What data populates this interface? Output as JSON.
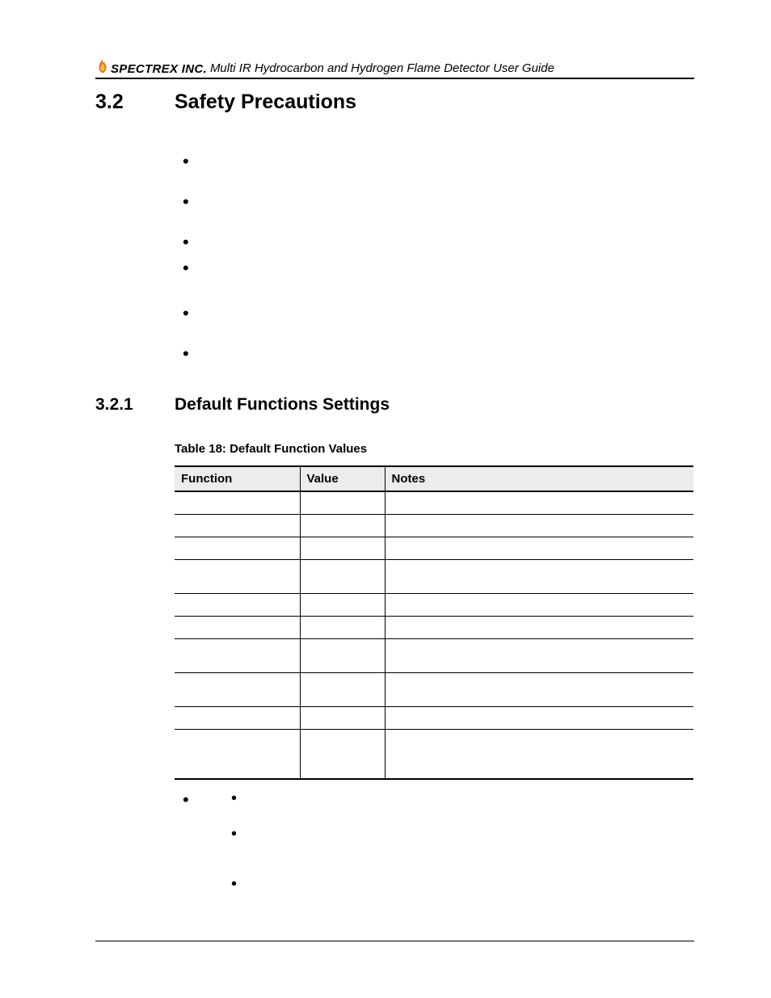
{
  "header": {
    "brand_main": "SPECTREX",
    "brand_suffix": " INC.",
    "doc_title": "Multi IR Hydrocarbon and Hydrogen Flame Detector User Guide"
  },
  "section": {
    "number": "3.2",
    "title": "Safety Precautions"
  },
  "safety_bullets": [
    "",
    "",
    "",
    "",
    "",
    ""
  ],
  "subsection": {
    "number": "3.2.1",
    "title": "Default Functions Settings"
  },
  "table": {
    "caption": "Table 18: Default Function Values",
    "headers": {
      "function": "Function",
      "value": "Value",
      "notes": "Notes"
    },
    "rows": [
      {
        "function": "",
        "value": "",
        "notes": "",
        "row_class": ""
      },
      {
        "function": "",
        "value": "",
        "notes": "",
        "row_class": ""
      },
      {
        "function": "",
        "value": "",
        "notes": "",
        "row_class": ""
      },
      {
        "function": "",
        "value": "",
        "notes": "",
        "row_class": "tall"
      },
      {
        "function": "",
        "value": "",
        "notes": "",
        "row_class": ""
      },
      {
        "function": "",
        "value": "",
        "notes": "",
        "row_class": ""
      },
      {
        "function": "",
        "value": "",
        "notes": "",
        "row_class": "tall"
      },
      {
        "function": "",
        "value": "",
        "notes": "",
        "row_class": "tall"
      },
      {
        "function": "",
        "value": "",
        "notes": "",
        "row_class": ""
      },
      {
        "function": "",
        "value": "",
        "notes": "",
        "row_class": "xtall"
      }
    ]
  },
  "footer_bullets": {
    "top": "",
    "subs": [
      "",
      "",
      ""
    ]
  }
}
